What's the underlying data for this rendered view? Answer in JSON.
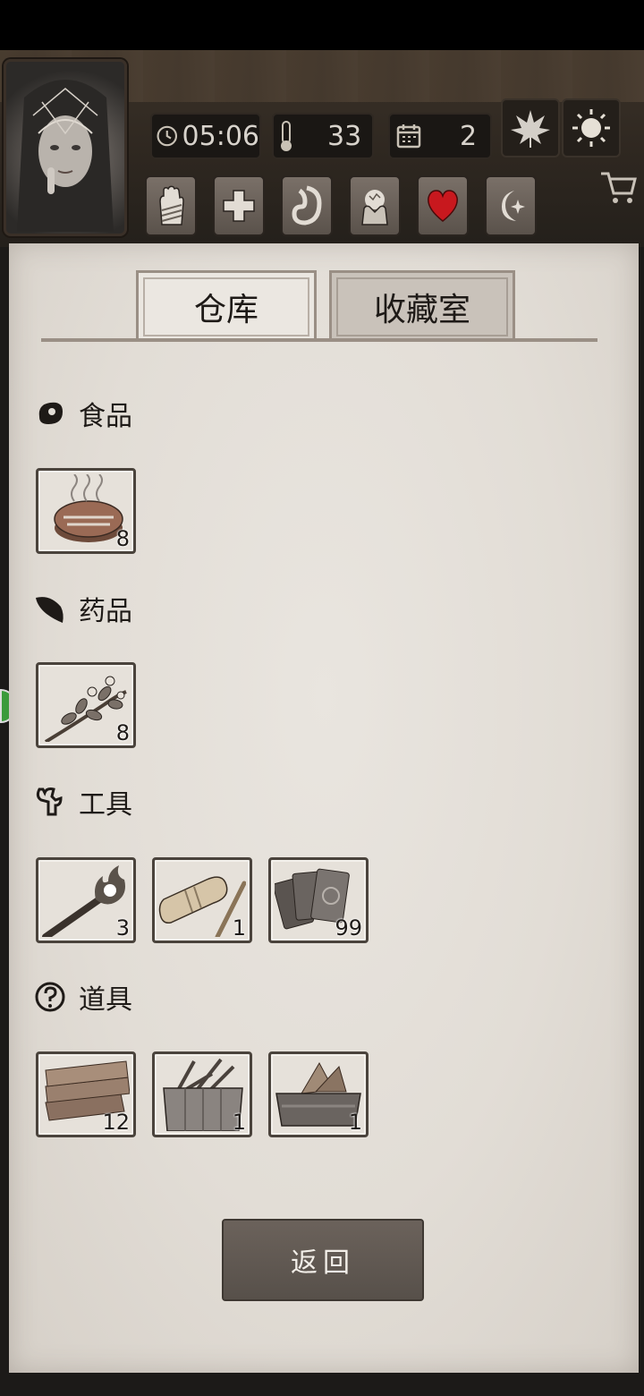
{
  "top": {
    "time": "05:06",
    "temperature": "33",
    "day": "2"
  },
  "tabs": {
    "warehouse": "仓库",
    "collection": "收藏室"
  },
  "sections": {
    "food": "食品",
    "medicine": "药品",
    "tools": "工具",
    "props": "道具"
  },
  "items": {
    "food": [
      {
        "name": "steak",
        "qty": "8"
      }
    ],
    "medicine": [
      {
        "name": "herb",
        "qty": "8"
      }
    ],
    "tools": [
      {
        "name": "torch",
        "qty": "3"
      },
      {
        "name": "flashlight",
        "qty": "1"
      },
      {
        "name": "cards",
        "qty": "99"
      }
    ],
    "props": [
      {
        "name": "planks",
        "qty": "12"
      },
      {
        "name": "scrap-box",
        "qty": "1"
      },
      {
        "name": "wood-basket",
        "qty": "1"
      }
    ]
  },
  "back_label": "返回",
  "colors": {
    "heart": "#c8181e",
    "paper": "#e6e1da",
    "dark": "#1e1a17"
  }
}
